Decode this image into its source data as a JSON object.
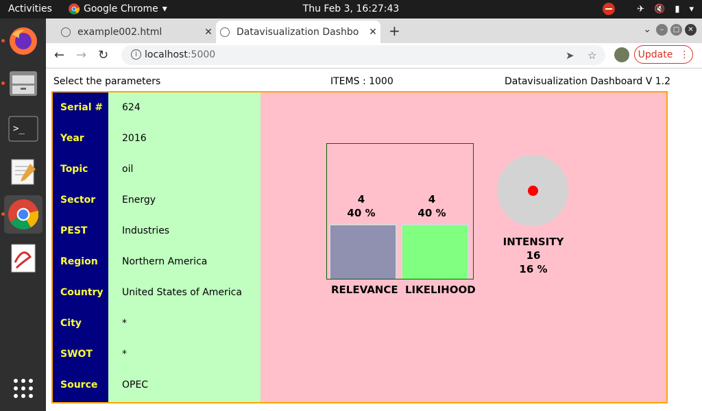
{
  "system": {
    "activities": "Activities",
    "app_name": "Google Chrome",
    "clock": "Thu Feb  3, 16:27:43"
  },
  "browser": {
    "tabs": [
      {
        "title": "example002.html",
        "active": false
      },
      {
        "title": "Datavisualization Dashbo",
        "active": true
      }
    ],
    "url_host": "localhost",
    "url_port": ":5000",
    "update_label": "Update"
  },
  "page": {
    "left_header": "Select the parameters",
    "items_label": "ITEMS : 1000",
    "version_label": "Datavisualization Dashboard V 1.2",
    "rows": [
      {
        "label": "Serial #",
        "value": "624"
      },
      {
        "label": "Year",
        "value": "2016"
      },
      {
        "label": "Topic",
        "value": "oil"
      },
      {
        "label": "Sector",
        "value": "Energy"
      },
      {
        "label": "PEST",
        "value": "Industries"
      },
      {
        "label": "Region",
        "value": "Northern America"
      },
      {
        "label": "Country",
        "value": "United States of America"
      },
      {
        "label": "City",
        "value": "*"
      },
      {
        "label": "SWOT",
        "value": "*"
      },
      {
        "label": "Source",
        "value": "OPEC"
      }
    ]
  },
  "chart_data": {
    "type": "bar",
    "categories": [
      "RELEVANCE",
      "LIKELIHOOD"
    ],
    "values": [
      4,
      4
    ],
    "value_labels": [
      "4",
      "4"
    ],
    "percent_labels": [
      "40 %",
      "40 %"
    ],
    "percent": [
      40,
      40
    ],
    "colors": [
      "#9090b0",
      "#80ff80"
    ],
    "intensity": {
      "label": "INTENSITY",
      "value_label": "16",
      "percent_label": "16 %",
      "percent": 16,
      "dot_color": "#ff0000"
    }
  }
}
